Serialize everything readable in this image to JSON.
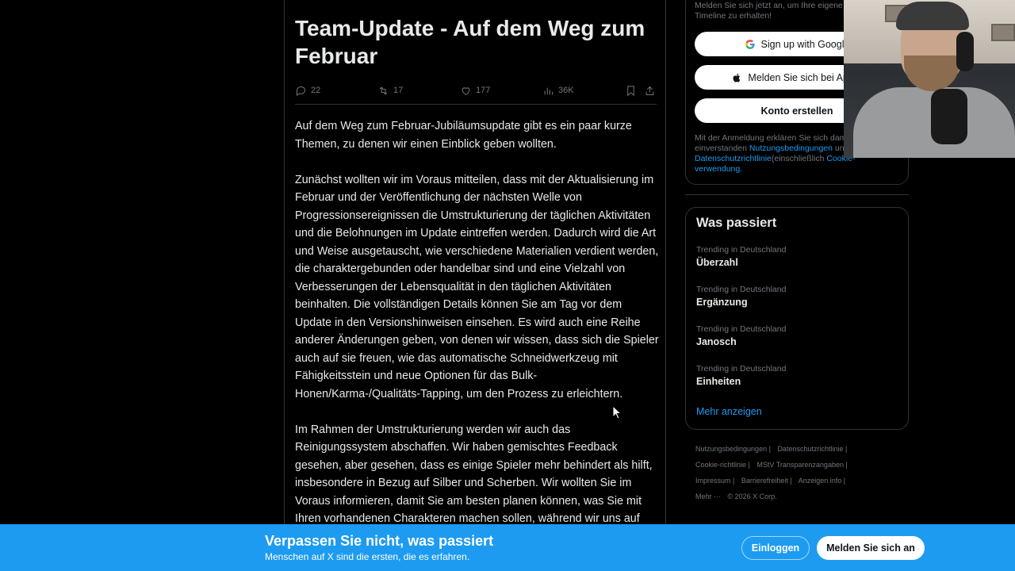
{
  "article": {
    "title": "Team-Update - Auf dem Weg zum Februar",
    "stats": {
      "replies": "22",
      "reposts": "17",
      "likes": "177",
      "views": "36K"
    },
    "paragraphs": [
      "Auf dem Weg zum Februar-Jubiläumsupdate gibt es ein paar kurze Themen, zu denen wir einen Einblick geben wollten.",
      "Zunächst wollten wir im Voraus mitteilen, dass mit der Aktualisierung im Februar und der Veröffentlichung der nächsten Welle von Progressionsereignissen die Umstrukturierung der täglichen Aktivitäten und die Belohnungen im Update eintreffen werden. Dadurch wird die Art und Weise ausgetauscht, wie verschiedene Materialien verdient werden, die charaktergebunden oder handelbar sind und eine Vielzahl von Verbesserungen der Lebensqualität in den täglichen Aktivitäten beinhalten. Die vollständigen Details können Sie am Tag vor dem Update in den Versionshinweisen einsehen. Es wird auch eine Reihe anderer Änderungen geben, von denen wir wissen, dass sich die Spieler auch auf sie freuen, wie das automatische Schneidwerkzeug mit Fähigkeitsstein und neue Optionen für das Bulk-Honen/Karma-/Qualitäts-Tapping, um den Prozess zu erleichtern.",
      "Im Rahmen der Umstrukturierung werden wir auch das Reinigungssystem abschaffen. Wir haben gemischtes Feedback gesehen, aber gesehen, dass es einige Spieler mehr behindert als hilft, insbesondere in Bezug auf Silber und Scherben. Wir wollten Sie im Voraus informieren, damit Sie am besten planen können, was Sie mit Ihren vorhandenen Charakteren machen sollen, während wir uns auf das"
    ]
  },
  "signup": {
    "hint": "Melden Sie sich jetzt an, um Ihre eigene personalisierte Timeline zu erhalten!",
    "google_label": "Sign up with Google",
    "apple_label": "Melden Sie sich bei Apple",
    "create_label": "Konto erstellen",
    "legal_prefix": "Mit der Anmeldung erklären Sie sich damit einverstanden",
    "terms_link": "Nutzungsbedingungen",
    "legal_and": "und",
    "privacy_link": "Datenschutzrichtlinie",
    "legal_incl": "(einschließlich",
    "cookie_link": "Cookie-verwendung."
  },
  "trends": {
    "title": "Was passiert",
    "items": [
      {
        "context": "Trending in Deutschland",
        "name": "Überzahl"
      },
      {
        "context": "Trending in Deutschland",
        "name": "Ergänzung"
      },
      {
        "context": "Trending in Deutschland",
        "name": "Janosch"
      },
      {
        "context": "Trending in Deutschland",
        "name": "Einheiten"
      }
    ],
    "more": "Mehr anzeigen"
  },
  "footer": {
    "links": [
      "Nutzungsbedingungen |",
      "Datenschutzrichtlinie |",
      "Cookie-richtlinie |",
      "MStV Transparenzangaben |",
      "Impressum |",
      "Barrierefreiheit |",
      "Anzeigen info |",
      "Mehr ···",
      "© 2026 X Corp."
    ]
  },
  "banner": {
    "title": "Verpassen Sie nicht, was passiert",
    "subtitle": "Menschen auf X sind die ersten, die es erfahren.",
    "login_label": "Einloggen",
    "register_label": "Melden Sie sich an"
  },
  "icons": {
    "reply": "reply-icon",
    "repost": "repost-icon",
    "like": "like-icon",
    "views": "views-icon",
    "bookmark": "bookmark-icon",
    "share": "share-icon",
    "google": "google-icon",
    "apple": "apple-icon"
  },
  "colors": {
    "background": "#000000",
    "accent": "#1d9bf0",
    "text": "#e7e9ea",
    "muted": "#71767b",
    "border": "#2f3336"
  }
}
